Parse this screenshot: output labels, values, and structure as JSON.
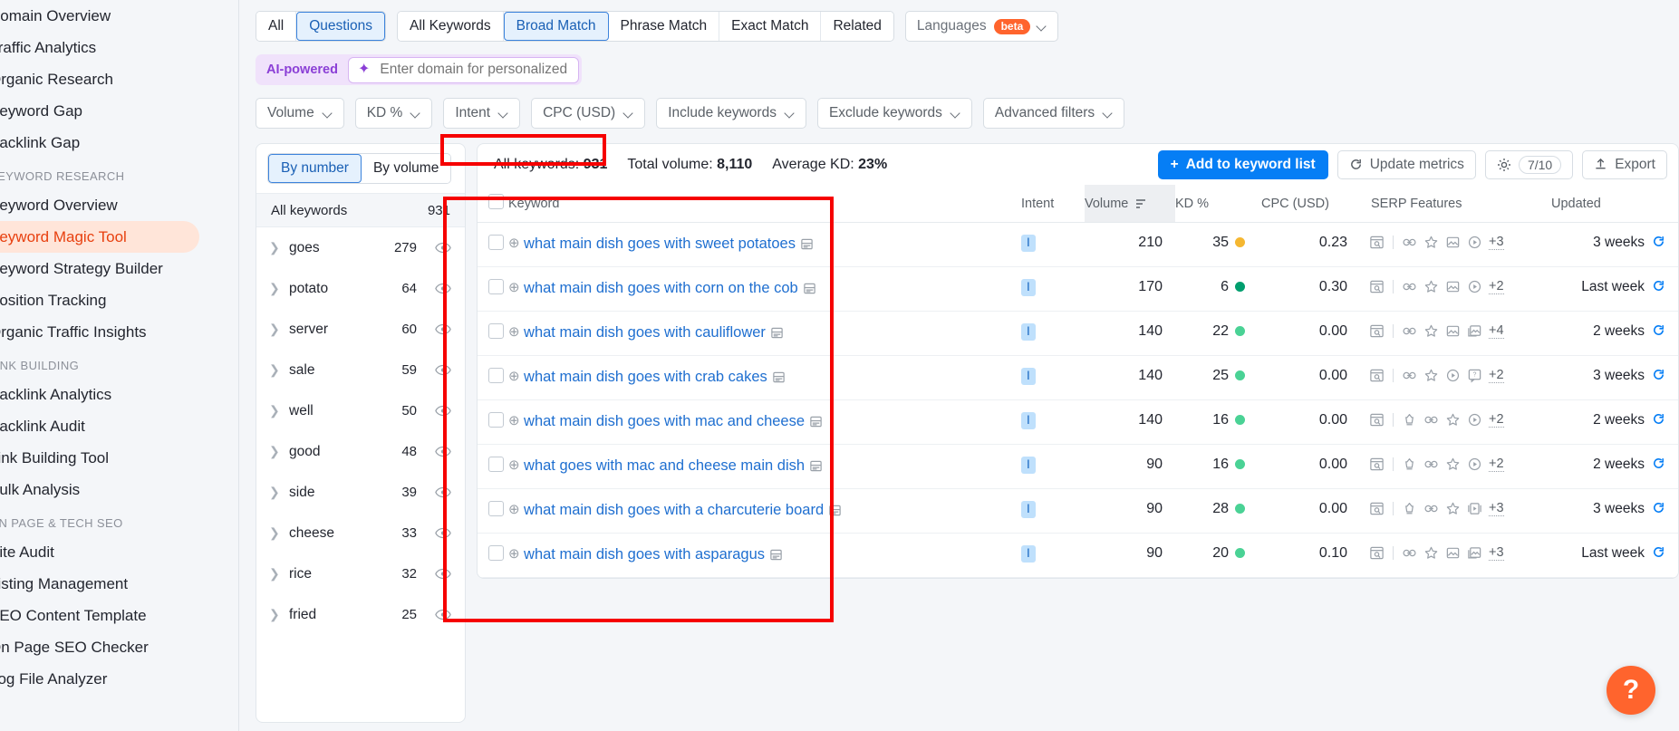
{
  "sidebar": {
    "items": [
      {
        "label": "Domain Overview",
        "type": "item",
        "active": false
      },
      {
        "label": "Traffic Analytics",
        "type": "item",
        "active": false
      },
      {
        "label": "Organic Research",
        "type": "item",
        "active": false
      },
      {
        "label": "Keyword Gap",
        "type": "item",
        "active": false
      },
      {
        "label": "Backlink Gap",
        "type": "item",
        "active": false
      },
      {
        "label": "KEYWORD RESEARCH",
        "type": "group"
      },
      {
        "label": "Keyword Overview",
        "type": "item",
        "active": false
      },
      {
        "label": "Keyword Magic Tool",
        "type": "item",
        "active": true
      },
      {
        "label": "Keyword Strategy Builder",
        "type": "item",
        "active": false
      },
      {
        "label": "Position Tracking",
        "type": "item",
        "active": false
      },
      {
        "label": "Organic Traffic Insights",
        "type": "item",
        "active": false
      },
      {
        "label": "LINK BUILDING",
        "type": "group"
      },
      {
        "label": "Backlink Analytics",
        "type": "item",
        "active": false
      },
      {
        "label": "Backlink Audit",
        "type": "item",
        "active": false
      },
      {
        "label": "Link Building Tool",
        "type": "item",
        "active": false
      },
      {
        "label": "Bulk Analysis",
        "type": "item",
        "active": false
      },
      {
        "label": "ON PAGE & TECH SEO",
        "type": "group"
      },
      {
        "label": "Site Audit",
        "type": "item",
        "active": false
      },
      {
        "label": "Listing Management",
        "type": "item",
        "active": false
      },
      {
        "label": "SEO Content Template",
        "type": "item",
        "active": false
      },
      {
        "label": "On Page SEO Checker",
        "type": "item",
        "active": false
      },
      {
        "label": "Log File Analyzer",
        "type": "item",
        "active": false
      }
    ]
  },
  "toolbar": {
    "question_segment": [
      {
        "label": "All",
        "selected": false
      },
      {
        "label": "Questions",
        "selected": true
      }
    ],
    "match_segment": [
      {
        "label": "All Keywords",
        "selected": false
      },
      {
        "label": "Broad Match",
        "selected": true
      },
      {
        "label": "Phrase Match",
        "selected": false
      },
      {
        "label": "Exact Match",
        "selected": false
      },
      {
        "label": "Related",
        "selected": false
      }
    ],
    "languages": {
      "label": "Languages",
      "badge": "beta"
    }
  },
  "ai_row": {
    "tag": "AI-powered",
    "placeholder": "Enter domain for personalized data",
    "value": ""
  },
  "filters": [
    {
      "label": "Volume"
    },
    {
      "label": "KD %"
    },
    {
      "label": "Intent"
    },
    {
      "label": "CPC (USD)"
    },
    {
      "label": "Include keywords"
    },
    {
      "label": "Exclude keywords"
    },
    {
      "label": "Advanced filters"
    }
  ],
  "groups_panel": {
    "sort_segment": [
      {
        "label": "By number",
        "selected": true
      },
      {
        "label": "By volume",
        "selected": false
      }
    ],
    "all_row": {
      "label": "All keywords",
      "count": "931"
    },
    "rows": [
      {
        "name": "goes",
        "count": "279"
      },
      {
        "name": "potato",
        "count": "64"
      },
      {
        "name": "server",
        "count": "60"
      },
      {
        "name": "sale",
        "count": "59"
      },
      {
        "name": "well",
        "count": "50"
      },
      {
        "name": "good",
        "count": "48"
      },
      {
        "name": "side",
        "count": "39"
      },
      {
        "name": "cheese",
        "count": "33"
      },
      {
        "name": "rice",
        "count": "32"
      },
      {
        "name": "fried",
        "count": "25"
      }
    ]
  },
  "stats": {
    "all_keywords_label": "All keywords:",
    "all_keywords_value": "931",
    "total_volume_label": "Total volume:",
    "total_volume_value": "8,110",
    "average_kd_label": "Average KD:",
    "average_kd_value": "23%",
    "add_to_list": "Add to keyword list",
    "update_metrics": "Update metrics",
    "quota": "7/10",
    "export": "Export"
  },
  "table": {
    "headers": {
      "keyword": "Keyword",
      "intent": "Intent",
      "volume": "Volume",
      "kd": "KD %",
      "cpc": "CPC (USD)",
      "serp": "SERP Features",
      "updated": "Updated"
    },
    "rows": [
      {
        "keyword": "what main dish goes with sweet potatoes",
        "wrap_icon": true,
        "intent": "I",
        "volume": "210",
        "kd": "35",
        "kd_color": "#f5b731",
        "cpc": "0.23",
        "serp_icons": [
          "serp-preview",
          "sitelinks",
          "reviews",
          "image-pack",
          "video"
        ],
        "serp_more": "+3",
        "updated": "3 weeks"
      },
      {
        "keyword": "what main dish goes with corn on the cob",
        "wrap_icon": true,
        "intent": "I",
        "volume": "170",
        "kd": "6",
        "kd_color": "#009e6e",
        "cpc": "0.30",
        "serp_icons": [
          "serp-preview",
          "sitelinks",
          "reviews",
          "image-pack",
          "video"
        ],
        "serp_more": "+2",
        "updated": "Last week"
      },
      {
        "keyword": "what main dish goes with cauliflower",
        "wrap_icon": false,
        "intent": "I",
        "volume": "140",
        "kd": "22",
        "kd_color": "#4ad295",
        "cpc": "0.00",
        "serp_icons": [
          "serp-preview",
          "sitelinks",
          "reviews",
          "image-pack",
          "image-carousel"
        ],
        "serp_more": "+4",
        "updated": "2 weeks"
      },
      {
        "keyword": "what main dish goes with crab cakes",
        "wrap_icon": false,
        "intent": "I",
        "volume": "140",
        "kd": "25",
        "kd_color": "#4ad295",
        "cpc": "0.00",
        "serp_icons": [
          "serp-preview",
          "sitelinks",
          "reviews",
          "video",
          "faq"
        ],
        "serp_more": "+2",
        "updated": "3 weeks"
      },
      {
        "keyword": "what main dish goes with mac and cheese",
        "wrap_icon": true,
        "intent": "I",
        "volume": "140",
        "kd": "16",
        "kd_color": "#4ad295",
        "cpc": "0.00",
        "serp_icons": [
          "serp-preview",
          "featured-snippet",
          "sitelinks",
          "reviews",
          "video"
        ],
        "serp_more": "+2",
        "updated": "2 weeks"
      },
      {
        "keyword": "what goes with mac and cheese main dish",
        "wrap_icon": true,
        "intent": "I",
        "volume": "90",
        "kd": "16",
        "kd_color": "#4ad295",
        "cpc": "0.00",
        "serp_icons": [
          "serp-preview",
          "featured-snippet",
          "sitelinks",
          "reviews",
          "video"
        ],
        "serp_more": "+2",
        "updated": "2 weeks"
      },
      {
        "keyword": "what main dish goes with a charcuterie board",
        "wrap_icon": false,
        "intent": "I",
        "volume": "90",
        "kd": "28",
        "kd_color": "#4ad295",
        "cpc": "0.00",
        "serp_icons": [
          "serp-preview",
          "featured-snippet",
          "sitelinks",
          "reviews",
          "video-carousel"
        ],
        "serp_more": "+3",
        "updated": "3 weeks"
      },
      {
        "keyword": "what main dish goes with asparagus",
        "wrap_icon": false,
        "intent": "I",
        "volume": "90",
        "kd": "20",
        "kd_color": "#4ad295",
        "cpc": "0.10",
        "serp_icons": [
          "serp-preview",
          "sitelinks",
          "reviews",
          "image-pack",
          "image-carousel"
        ],
        "serp_more": "+3",
        "updated": "Last week"
      }
    ]
  },
  "help": {
    "label": "?"
  },
  "colors": {
    "accent_blue": "#067ef5",
    "brand_orange": "#ff642d",
    "annotation_red": "#f60000",
    "ai_purple": "#8b3fd6"
  }
}
